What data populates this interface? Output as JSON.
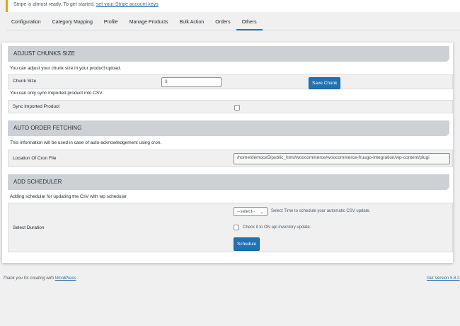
{
  "notice": {
    "text": "Stripe is almost ready. To get started,",
    "link": "set your Stripe account keys"
  },
  "tabs": [
    "Configuration",
    "Category Mapping",
    "Profile",
    "Manage Products",
    "Bulk Action",
    "Orders",
    "Others"
  ],
  "active_tab": "Others",
  "chunks": {
    "title": "ADJUST CHUNKS SIZE",
    "desc": "You can adjust your chunk size in your product upload.",
    "label": "Chunk Size",
    "value": "3",
    "button": "Save Chunk",
    "sync_desc": "You can only sync Imported product into CSV.",
    "sync_label": "Sync Imported Product"
  },
  "orders": {
    "title": "AUTO ORDER FETCHING",
    "desc": "This information will be used in case of auto-acknowledgement using cron.",
    "label": "Location Of Cron File",
    "value": "/home/democe5/public_html/woocommerce/woocommerce-fruugo-integration/wp-content/plugi"
  },
  "scheduler": {
    "title": "ADD SCHEDULER",
    "desc": "Adding schedular for updating the CsV with wp schedular",
    "label": "Select Duration",
    "select": "--select--",
    "select_hint": "Select Time to schedule your automatic CSV update.",
    "check_label": "Check it to ON api inventory update.",
    "button": "Schedule"
  },
  "footer": {
    "text": "Thank you for creating with",
    "link": "WordPress",
    "version": "Get Version 5.8.2"
  }
}
